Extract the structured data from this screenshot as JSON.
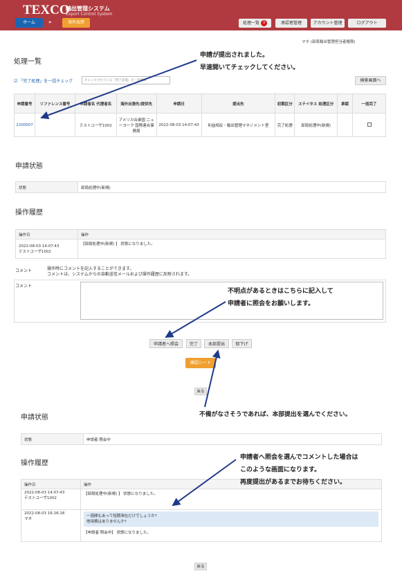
{
  "header": {
    "logo": "TEXCO",
    "app_title": "輸出管理システム",
    "app_subtitle": "Export Control System",
    "home": "ホーム",
    "separator": "»",
    "overseas": "海外出張",
    "nav_list": "処理一覧",
    "nav_badge": "3",
    "nav_approver": "承認者管理",
    "nav_account": "アカウント管理",
    "nav_logout": "ログアウト",
    "user": "マネ (部局輸出管理担当者権限)"
  },
  "list_section": {
    "title": "処理一覧",
    "check_label": "「完了処理」を一括チェック",
    "check_placeholder": "チェックされている「完了処理」を一括更新",
    "search_button": "検索画面へ",
    "columns": [
      "申請番号",
      "リファレンス番号",
      "申請者名 代理者名",
      "海外出張先/提供先",
      "申請日",
      "提出先",
      "初期区分",
      "ステイタス 処理区分",
      "承認",
      "一括完了"
    ],
    "row": {
      "id": "2200007",
      "ref": "",
      "applicant": "テストユーザ1002",
      "destination": "アメリカ合衆国 ニューヨーク 国際連合事務局",
      "date": "2022-08-03 14:07:43",
      "submit_to": "利益相反・輸出管理マネジメント室",
      "initial": "完了処理",
      "status": "部局処理中(新規)",
      "approve": ""
    }
  },
  "status1": {
    "title": "申請状態",
    "label": "状態",
    "value": "部局処理中(新規)"
  },
  "history1": {
    "title": "操作履歴",
    "col_date": "操作日",
    "col_op": "操作",
    "rows": [
      {
        "date": "2022-08-03 14:07:43",
        "user": "テストユーザ1002",
        "op": "【部局処理中(新規) 】 状態になりました。"
      }
    ]
  },
  "comment": {
    "note_label": "コメント",
    "desc1": "操作時にコメントを記入することができます。",
    "desc2": "コメントは、システムからの自動送信メールおよび操作履歴に反映されます。",
    "field_label": "コメント"
  },
  "actions": {
    "inquiry": "申請者へ照会",
    "complete": "完了",
    "hq_submit": "本部提出",
    "withdraw": "取下げ",
    "confirm_sheet": "確認シート",
    "back": "戻る"
  },
  "status2": {
    "title": "申請状態",
    "label": "状態",
    "value": "申請者 照会中"
  },
  "history2": {
    "title": "操作履歴",
    "col_date": "操作日",
    "col_op": "操作",
    "row1": {
      "date": "2022-08-03 14:07:43",
      "user": "テストユーザ1002",
      "op": "【部局処理中(新規) 】 状態になりました。"
    },
    "row2": {
      "date": "2022-08-03 16:26:18",
      "user": "マネ",
      "c1": "一週間もあって短期滞在だけでしょうか?",
      "c2": "他用務はありませんか?",
      "op": "【申請者 照会中】 状態になりました。"
    }
  },
  "annotations": {
    "a1_l1": "申請が提出されました。",
    "a1_l2": "早速開いてチェックしてください。",
    "a2_l1": "不明点があるときはこちらに記入して",
    "a2_l2": "申請者に照会をお願いします。",
    "a3": "不備がなさそうであれば、本部提出を選んでください。",
    "a4_l1": "申請者へ照会を選んでコメントした場合は",
    "a4_l2": "このような画面になります。",
    "a4_l3": "再度提出があるまでお待ちください。"
  }
}
